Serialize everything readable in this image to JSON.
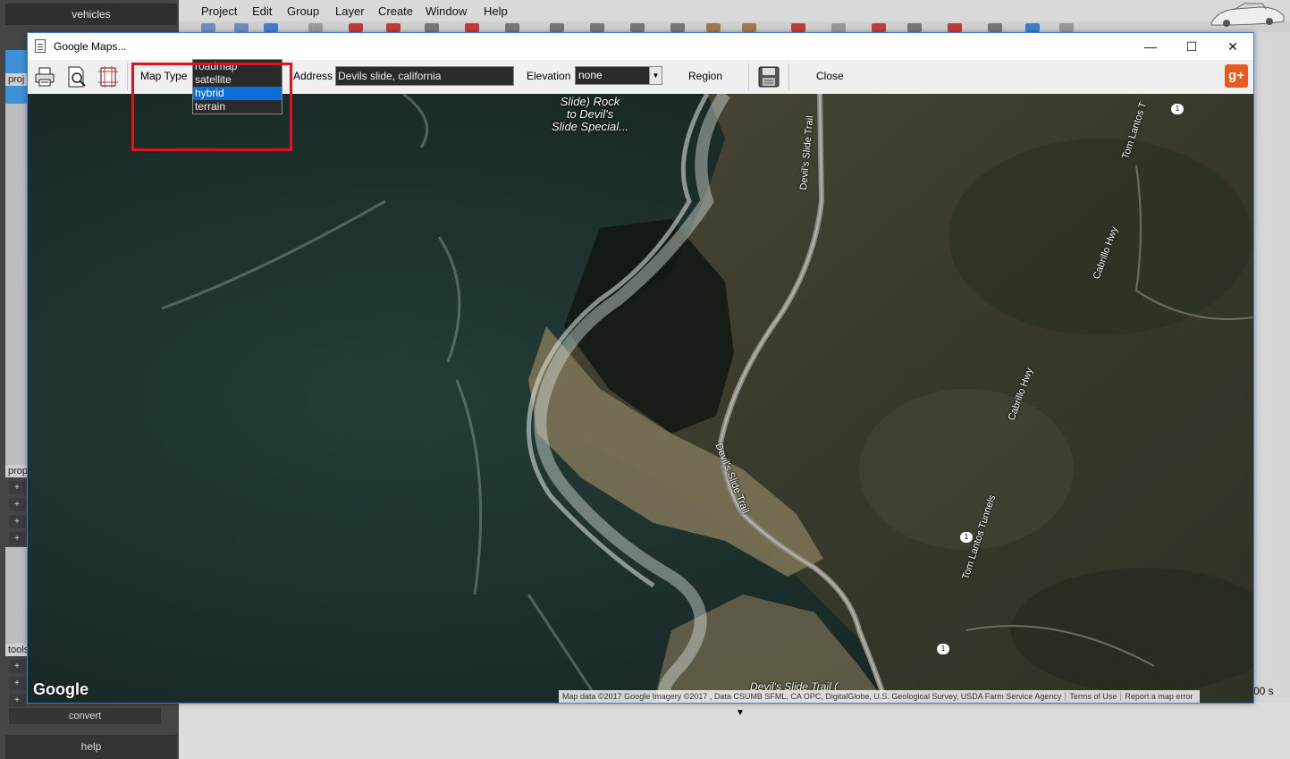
{
  "app": {
    "menu": [
      "Project",
      "Edit",
      "Group",
      "Layer",
      "Create",
      "Window",
      "Help"
    ],
    "left_panel": {
      "header": "vehicles",
      "sections": [
        "proj",
        "prop",
        "tools"
      ],
      "convert_label": "convert",
      "help_label": "help",
      "plus": "+"
    },
    "time_readout": "00 s"
  },
  "dialog": {
    "title": "Google Maps...",
    "window_controls": {
      "minimize": "—",
      "maximize": "☐",
      "close": "✕"
    },
    "toolbar": {
      "map_type_label": "Map Type",
      "map_type_value": "hybrid",
      "map_type_options": [
        "roadmap",
        "satellite",
        "hybrid",
        "terrain"
      ],
      "map_type_selected_index": 2,
      "address_label": "Address",
      "address_value": "Devils slide, california",
      "elevation_label": "Elevation",
      "elevation_value": "none",
      "region_label": "Region",
      "close_label": "Close",
      "gplus_label": "g+"
    },
    "map": {
      "place_label_lines": [
        "Slide) Rock",
        "to Devil's",
        "Slide Special..."
      ],
      "road_labels": {
        "trail_top": "Devil's Slide Trail",
        "trail_mid": "Devil's Slide Trail",
        "trail_bottom": "Devil's Slide Trail (",
        "cabrillo_1": "Cabrillo Hwy",
        "cabrillo_2": "Cabrillo Hwy",
        "tunnels_1": "Tom Lantos Tunnels",
        "tunnels_2": "Tom Lantos T"
      },
      "route_shield": "1",
      "logo": "Google",
      "attribution": [
        "Map data ©2017 Google Imagery ©2017 , Data CSUMB SFML, CA OPC, DigitalGlobe, U.S. Geological Survey, USDA Farm Service Agency",
        "Terms of Use",
        "Report a map error"
      ]
    }
  },
  "colors": {
    "highlight": "#e0121c",
    "selected_option": "#0a6fd6",
    "ocean": "#1f3330",
    "land": "#3b3a2c"
  }
}
